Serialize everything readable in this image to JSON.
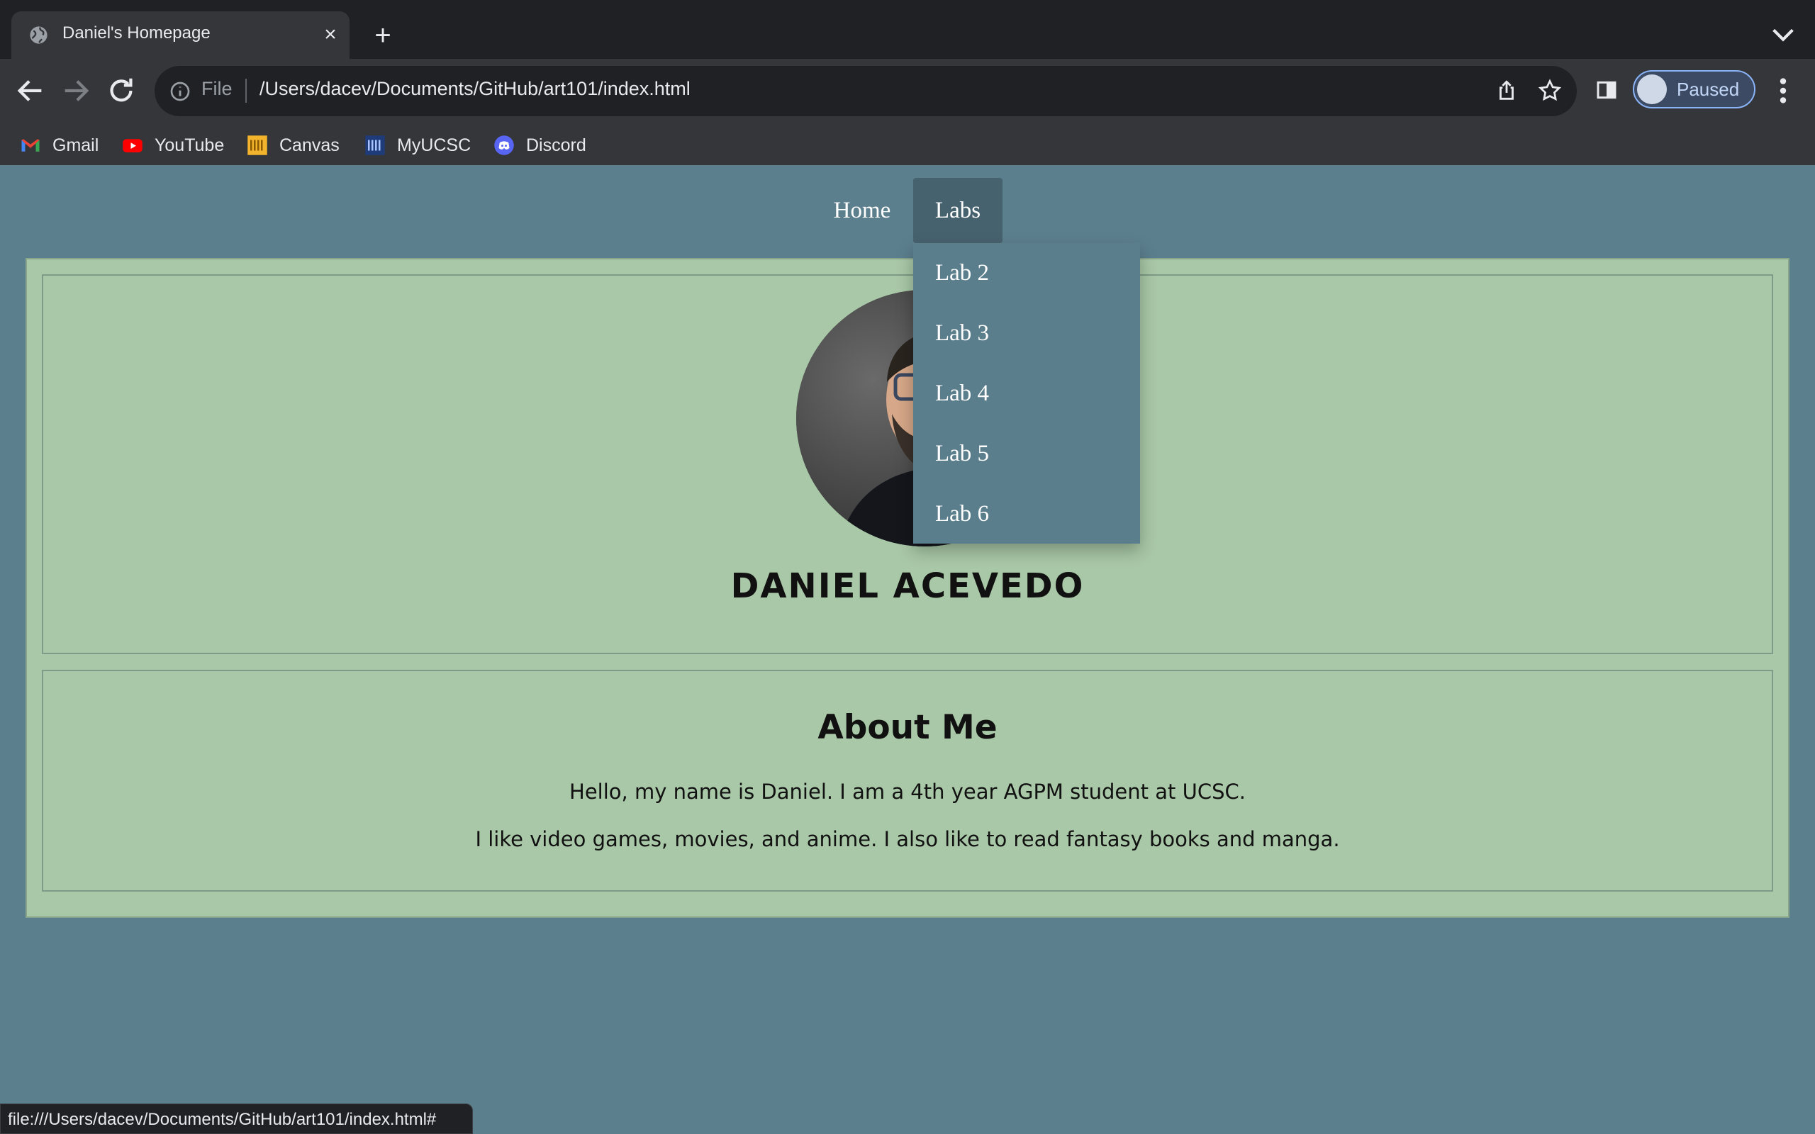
{
  "browser": {
    "tab_title": "Daniel's Homepage",
    "address_scheme": "File",
    "address_url": "/Users/dacev/Documents/GitHub/art101/index.html",
    "profile_label": "Paused",
    "bookmarks": [
      "Gmail",
      "YouTube",
      "Canvas",
      "MyUCSC",
      "Discord"
    ],
    "status_url": "file:///Users/dacev/Documents/GitHub/art101/index.html#"
  },
  "nav": {
    "home": "Home",
    "labs": "Labs",
    "labs_menu": [
      "Lab 2",
      "Lab 3",
      "Lab 4",
      "Lab 5",
      "Lab 6"
    ]
  },
  "profile": {
    "name": "DANIEL ACEVEDO"
  },
  "about": {
    "title": "About Me",
    "line1": "Hello, my name is Daniel. I am a 4th year AGPM student at UCSC.",
    "line2": "I like video games, movies, and anime. I also like to read fantasy books and manga."
  },
  "colors": {
    "page_bg": "#5c7f8e",
    "card_bg": "#a9c8a7",
    "nav_active": "#47626f",
    "dropdown_bg": "#5b7e8c"
  }
}
